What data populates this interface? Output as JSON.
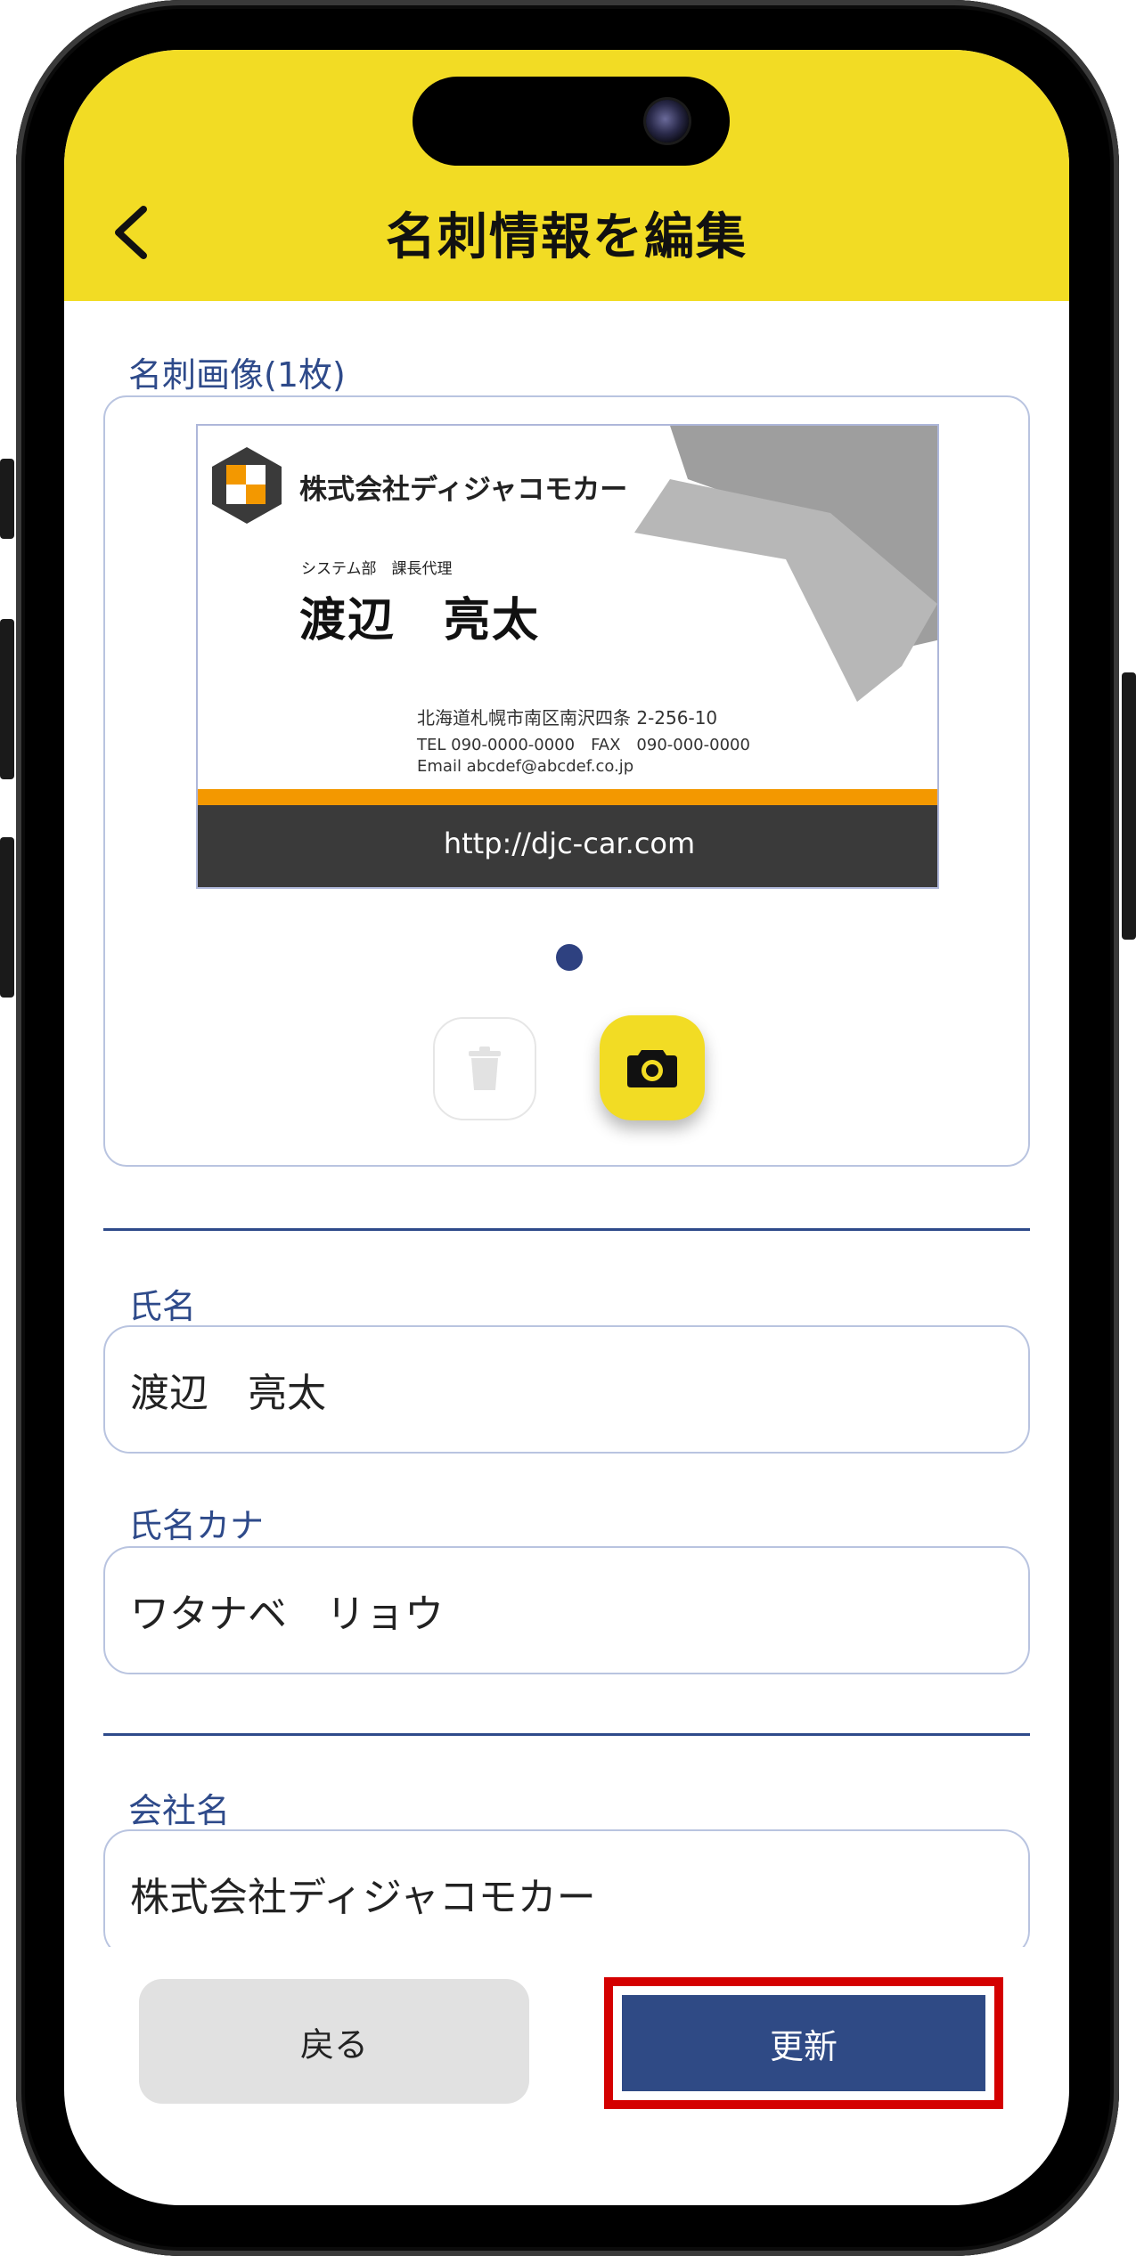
{
  "header": {
    "title": "名刺情報を編集"
  },
  "card_image_section": {
    "label": "名刺画像(1枚)",
    "card": {
      "company": "株式会社ディジャコモカー",
      "position": "システム部　課長代理",
      "name": "渡辺　亮太",
      "address": "北海道札幌市南区南沢四条 2-256-10",
      "phone_fax": "TEL 090-0000-0000　FAX　090-000-0000",
      "email": "Email abcdef@abcdef.co.jp",
      "url": "http://djc-car.com"
    }
  },
  "form": {
    "name_label": "氏名",
    "name_value": "渡辺　亮太",
    "kana_label": "氏名カナ",
    "kana_value": "ワタナベ　リョウ",
    "company_label": "会社名",
    "company_value": "株式会社ディジャコモカー"
  },
  "footer": {
    "back_label": "戻る",
    "update_label": "更新"
  },
  "colors": {
    "header_bg": "#f2dc24",
    "accent_blue": "#2f4a85",
    "highlight_red": "#d40000",
    "card_orange": "#f39800",
    "card_footer": "#3a3a3a"
  },
  "icons": [
    "chevron-left-icon",
    "trash-icon",
    "camera-icon"
  ]
}
